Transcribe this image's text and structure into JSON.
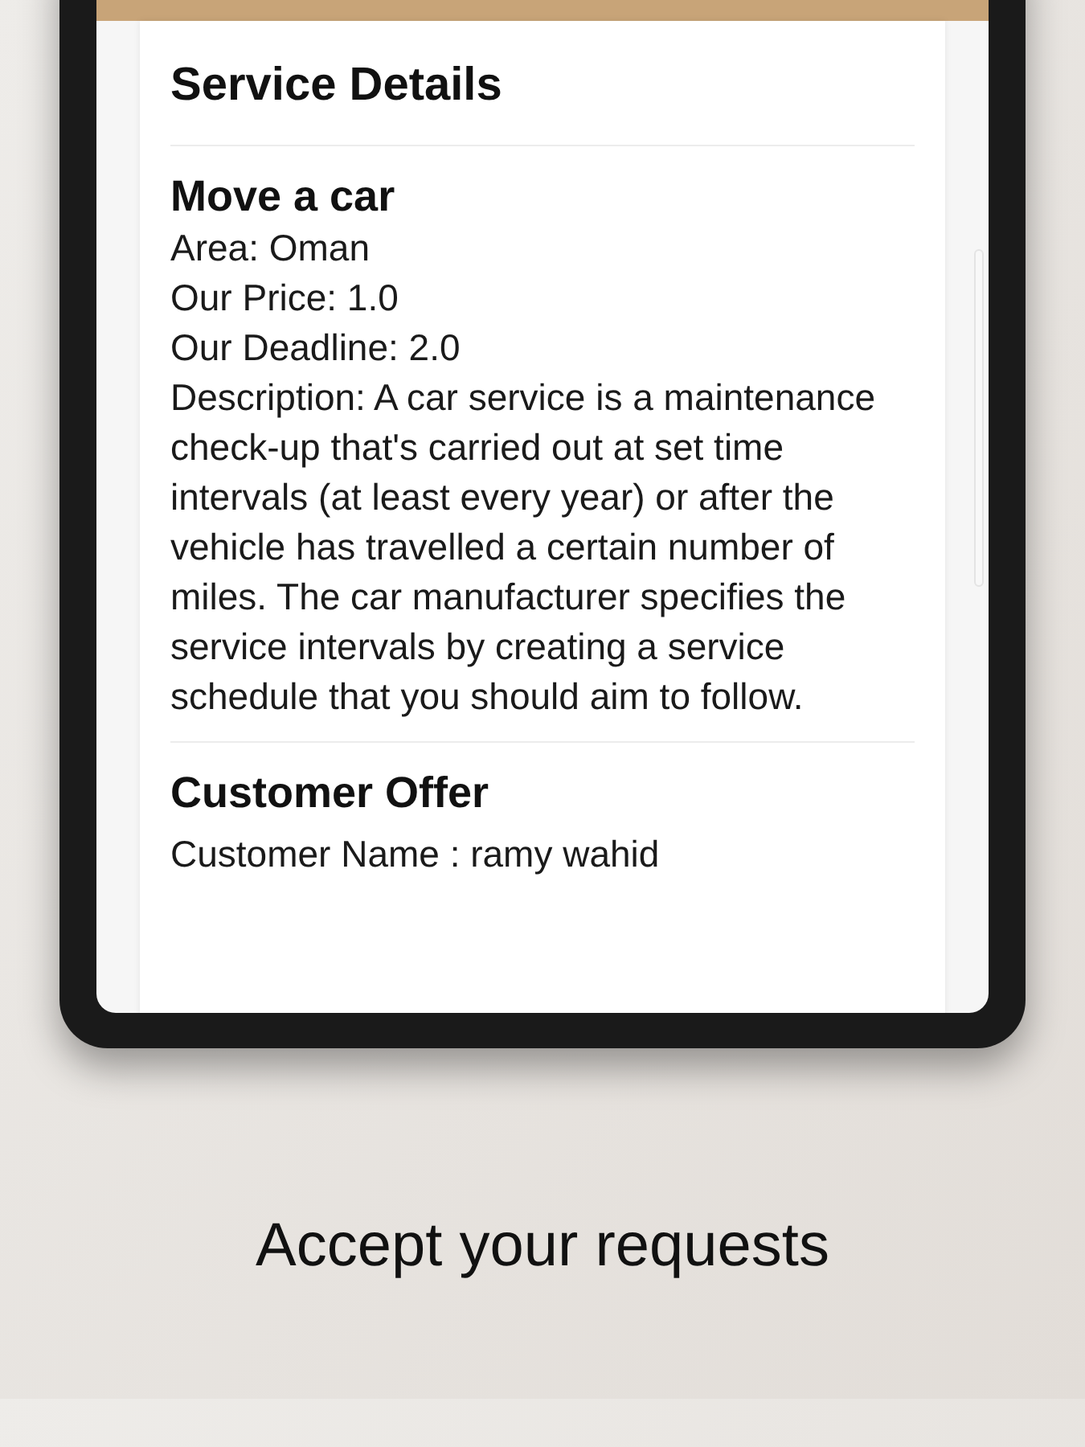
{
  "card": {
    "title": "Service Details",
    "sections": [
      {
        "heading": "Move a car",
        "lines": [
          "Area: Oman",
          "Our Price: 1.0",
          "Our Deadline: 2.0",
          "Description: A car service is a maintenance check-up that's carried out at set time intervals (at least every year) or after the vehicle has travelled a certain number of miles. The car manufacturer specifies the service intervals by creating a service schedule that you should aim to follow."
        ]
      },
      {
        "heading": "Customer Offer",
        "lines": [
          "Customer Name : ramy wahid"
        ]
      }
    ]
  },
  "caption": "Accept your requests"
}
